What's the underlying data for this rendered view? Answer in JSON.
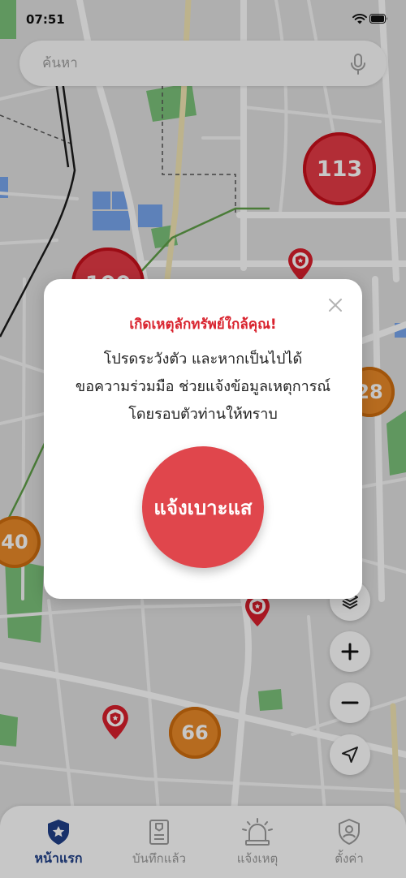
{
  "status_bar": {
    "time": "07:51",
    "icons": [
      "wifi-icon",
      "battery-icon"
    ]
  },
  "search": {
    "placeholder": "ค้นหา",
    "voice_icon": "microphone-icon"
  },
  "map": {
    "clusters": [
      {
        "count": "113"
      },
      {
        "count": "100"
      },
      {
        "count": "28"
      },
      {
        "count": "40"
      },
      {
        "count": "66"
      }
    ],
    "pin_icon": "shield-star-pin-icon",
    "controls": [
      "layers-icon",
      "zoom-in-icon",
      "zoom-out-icon",
      "locate-arrow-icon"
    ]
  },
  "alert_modal": {
    "title": "เกิดเหตุลักทรัพย์ใกล้คุณ!",
    "message_lines": [
      "โปรดระวังตัว และหากเป็นไปได้",
      "ขอความร่วมมือ ช่วยแจ้งข้อมูลเหตุการณ์",
      "โดยรอบตัวท่านให้ทราบ"
    ],
    "action_label": "แจ้งเบาะแส",
    "close_icon": "close-icon"
  },
  "bottom_nav": {
    "items": [
      {
        "label": "หน้าแรก",
        "icon": "shield-star-icon",
        "active": true
      },
      {
        "label": "บันทึกแล้ว",
        "icon": "notebook-icon",
        "active": false
      },
      {
        "label": "แจ้งเหตุ",
        "icon": "siren-icon",
        "active": false
      },
      {
        "label": "ตั้งค่า",
        "icon": "shield-user-icon",
        "active": false
      }
    ]
  },
  "theme": {
    "alert_title": "#d9232e",
    "action_button": "#e0464c",
    "cluster_red": "#e53a46",
    "cluster_orange": "#ea8a28",
    "pin_red": "#d91f2c",
    "nav_active": "#1f3f88",
    "nav_inactive": "#9b9b9b"
  }
}
